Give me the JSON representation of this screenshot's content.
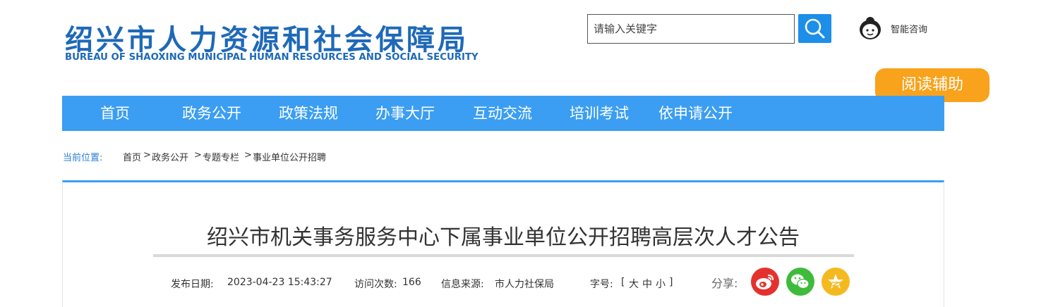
{
  "header": {
    "logo_cn": "绍兴市人力资源和社会保障局",
    "logo_en": "BUREAU OF SHAOXING MUNICIPAL HUMAN RESOURCES AND SOCIAL SECURITY",
    "search_placeholder": "请输入关键字",
    "consult_label": "智能咨询",
    "reading_aid_label": "阅读辅助"
  },
  "nav": {
    "items": [
      "首页",
      "政务公开",
      "政策法规",
      "办事大厅",
      "互动交流",
      "培训考试",
      "依申请公开"
    ]
  },
  "breadcrumb": {
    "label": "当前位置:",
    "items": [
      "首页",
      "政务公开",
      "专题专栏",
      "事业单位公开招聘"
    ],
    "separator": ">"
  },
  "article": {
    "title": "绍兴市机关事务服务中心下属事业单位公开招聘高层次人才公告",
    "publish_label": "发布日期:",
    "publish_date": "2023-04-23 15:43:27",
    "visits_label": "访问次数:",
    "visits": "166",
    "source_label": "信息来源:",
    "source": "市人力社保局",
    "fontsize_label": "字号:",
    "fontsize_open": "[",
    "fontsize_large": "大",
    "fontsize_medium": "中",
    "fontsize_small": "小",
    "fontsize_close": "]",
    "share_label": "分享:"
  },
  "share": {
    "buttons": [
      {
        "icon": "weibo-icon",
        "color": "#e5312e"
      },
      {
        "icon": "wechat-icon",
        "color": "#3fbb3c"
      },
      {
        "icon": "qzone-icon",
        "color": "#f5b920"
      }
    ]
  },
  "colors": {
    "brand": "#1e69b8",
    "nav": "#3b9ef2",
    "accent": "#f9a21b",
    "search_button": "#1d8fe8"
  }
}
